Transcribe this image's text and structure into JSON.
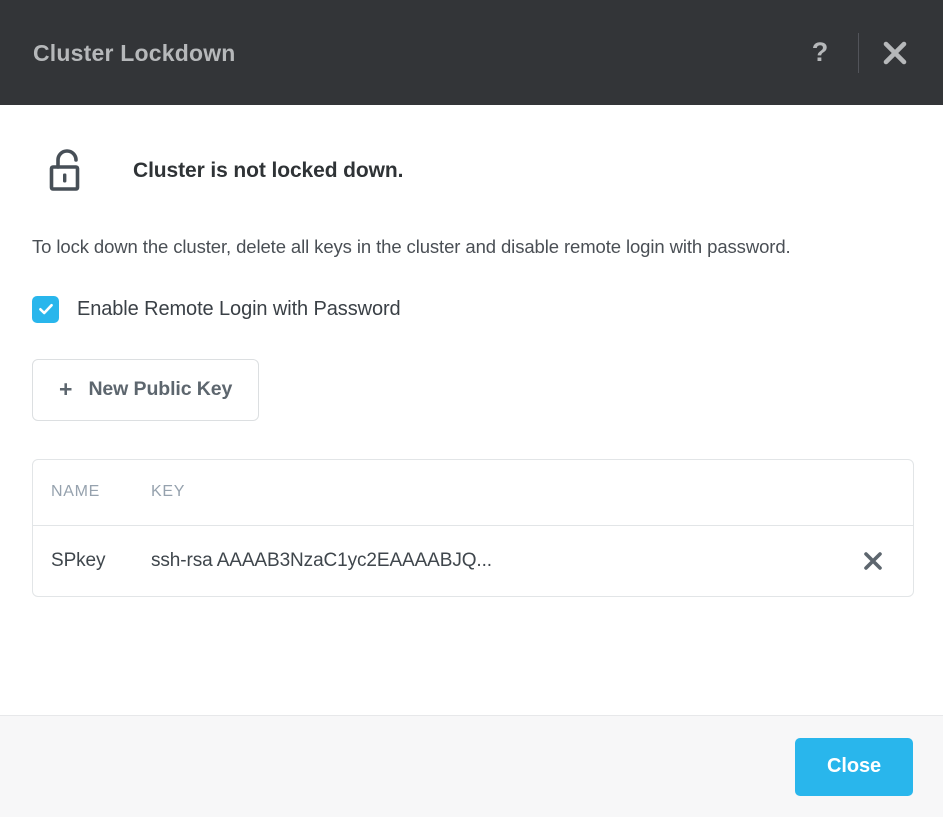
{
  "titlebar": {
    "title": "Cluster Lockdown",
    "help_label": "?",
    "help_icon": "question-mark-icon",
    "close_icon": "close-icon"
  },
  "status": {
    "icon": "unlock-icon",
    "text": "Cluster is not locked down."
  },
  "description": "To lock down the cluster, delete all keys in the cluster and disable remote login with password.",
  "checkbox": {
    "label": "Enable Remote Login with Password",
    "checked": true,
    "icon": "check-icon",
    "color": "#29b6ec"
  },
  "new_key_button": {
    "label": "New Public Key",
    "icon": "plus-icon"
  },
  "key_table": {
    "columns": [
      "NAME",
      "KEY"
    ],
    "rows": [
      {
        "name": "SPkey",
        "key": "ssh-rsa AAAAB3NzaC1yc2EAAAABJQ...",
        "delete_icon": "close-icon"
      }
    ]
  },
  "footer": {
    "close_label": "Close",
    "accent_color": "#29b6ec"
  }
}
